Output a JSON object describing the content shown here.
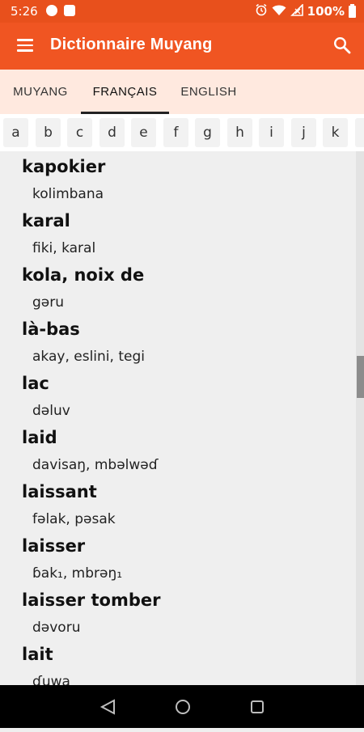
{
  "status": {
    "time": "5:26",
    "battery": "100%"
  },
  "app": {
    "title": "Dictionnaire Muyang"
  },
  "tabs": [
    {
      "label": "MUYANG"
    },
    {
      "label": "FRANÇAIS"
    },
    {
      "label": "ENGLISH"
    }
  ],
  "letters": [
    "a",
    "b",
    "c",
    "d",
    "e",
    "f",
    "g",
    "h",
    "i",
    "j",
    "k"
  ],
  "entries": [
    {
      "head": "kapokier",
      "trans": "kolimbana"
    },
    {
      "head": "karal",
      "trans": "fiki, karal"
    },
    {
      "head": "kola, noix de",
      "trans": "gəru"
    },
    {
      "head": "là-bas",
      "trans": "akay, eslini, tegi"
    },
    {
      "head": "lac",
      "trans": "dəluv"
    },
    {
      "head": "laid",
      "trans": "davisaŋ, mbəlwəɗ"
    },
    {
      "head": "laissant",
      "trans": "fəlak, pəsak"
    },
    {
      "head": "laisser",
      "trans": "ɓak₁, mbrəŋ₁"
    },
    {
      "head": "laisser tomber",
      "trans": "dəvoru"
    },
    {
      "head": "lait",
      "trans": "ɗuwa"
    }
  ],
  "icons": {
    "menu": "menu-icon",
    "search": "search-icon",
    "back": "nav-back-icon",
    "home": "nav-home-icon",
    "recents": "nav-recents-icon"
  },
  "colors": {
    "primary": "#f05522",
    "tab_background": "#ffe9df",
    "list_background": "#efefef"
  }
}
